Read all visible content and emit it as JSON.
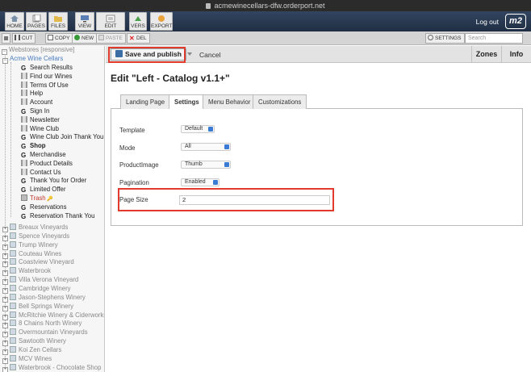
{
  "browser": {
    "url": "acmewinecellars-dfw.orderport.net"
  },
  "topnav": {
    "buttons": [
      {
        "label": "HOME"
      },
      {
        "label": "PAGES"
      },
      {
        "label": "FILES"
      },
      {
        "label": "VIEW"
      },
      {
        "label": "EDIT"
      },
      {
        "label": "VERS"
      },
      {
        "label": "EXPORT"
      }
    ],
    "logout": "Log out",
    "logo": "m2"
  },
  "toolbar": {
    "cut": "CUT",
    "copy": "COPY",
    "new": "NEW",
    "paste": "PASTE",
    "del": "DEL",
    "settings": "SETTINGS",
    "search_placeholder": "Search"
  },
  "tree": {
    "root": "Webstores [responsive]",
    "store": "Acme Wine Cellars",
    "pages": [
      {
        "label": "Search Results",
        "icon": "g-icon",
        "style": ""
      },
      {
        "label": "Find our Wines",
        "icon": "page-icon",
        "style": ""
      },
      {
        "label": "Terms Of Use",
        "icon": "page-icon",
        "style": ""
      },
      {
        "label": "Help",
        "icon": "page-icon",
        "style": ""
      },
      {
        "label": "Account",
        "icon": "page-icon",
        "style": ""
      },
      {
        "label": "Sign In",
        "icon": "g-icon",
        "style": ""
      },
      {
        "label": "Newsletter",
        "icon": "page-icon",
        "style": ""
      },
      {
        "label": "Wine Club",
        "icon": "page-icon",
        "style": ""
      },
      {
        "label": "Wine Club Join Thank You",
        "icon": "g-icon",
        "style": ""
      },
      {
        "label": "Shop",
        "icon": "g-icon",
        "style": "bold"
      },
      {
        "label": "Merchandise",
        "icon": "g-icon",
        "style": ""
      },
      {
        "label": "Product Details",
        "icon": "page-icon",
        "style": ""
      },
      {
        "label": "Contact Us",
        "icon": "page-icon",
        "style": ""
      },
      {
        "label": "Thank You for Order",
        "icon": "g-icon",
        "style": ""
      },
      {
        "label": "Limited Offer",
        "icon": "g-icon",
        "style": ""
      },
      {
        "label": "Trash",
        "icon": "trash-icon",
        "style": "red"
      },
      {
        "label": "Reservations",
        "icon": "g-icon",
        "style": ""
      },
      {
        "label": "Reservation Thank You",
        "icon": "g-icon",
        "style": ""
      }
    ],
    "stores": [
      "Breaux Vineyards",
      "Spence Vineyards",
      "Trump Winery",
      "Couteau Wines",
      "Coastview Vineyard",
      "Waterbrook",
      "Villa Verona Vineyard",
      "Cambridge Winery",
      "Jason-Stephens Winery",
      "Bell Springs Winery",
      "McRitchie Winery & Ciderworks",
      "8 Chains North Winery",
      "Overmountain Vineyards",
      "Sawtooth Winery",
      "Koi Zen Cellars",
      "MCV Wines",
      "Waterbrook - Chocolate Shop"
    ]
  },
  "actions": {
    "save": "Save and publish",
    "cancel": "Cancel",
    "zones": "Zones",
    "info": "Info"
  },
  "editor": {
    "title": "Edit \"Left - Catalog v1.1+\"",
    "tabs": [
      "Landing Page",
      "Settings",
      "Menu Behavior",
      "Customizations"
    ],
    "active_tab": "Settings",
    "fields": {
      "template": {
        "label": "Template",
        "value": "Default"
      },
      "mode": {
        "label": "Mode",
        "value": "All"
      },
      "product_image": {
        "label": "ProductImage",
        "value": "Thumb"
      },
      "pagination": {
        "label": "Pagination",
        "value": "Enabled"
      },
      "page_size": {
        "label": "Page Size",
        "value": "2"
      }
    }
  }
}
